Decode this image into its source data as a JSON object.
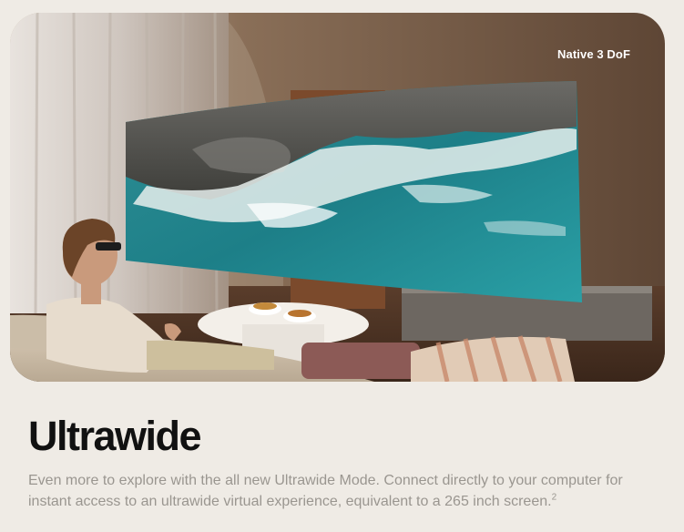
{
  "hero": {
    "badge": "Native 3 DoF"
  },
  "heading": "Ultrawide",
  "description": {
    "text": "Even more to explore with the all new Ultrawide Mode. Connect directly to your computer for instant access to an ultrawide virtual experience, equivalent to a 265 inch screen.",
    "footnote": "2"
  },
  "colors": {
    "page_background": "#efebe5",
    "heading": "#111111",
    "body_text": "#9a9690",
    "badge_text": "#ffffff"
  }
}
